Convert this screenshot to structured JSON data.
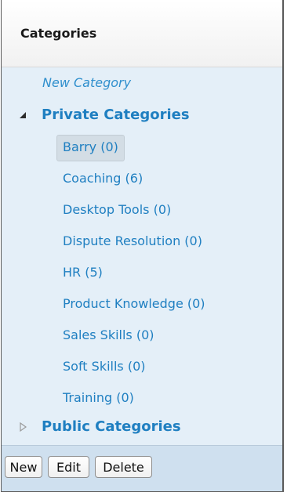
{
  "header": {
    "title": "Categories"
  },
  "tree": {
    "new_category": "New Category",
    "private_group": {
      "label": "Private Categories",
      "expanded": true,
      "items": [
        {
          "label": "Barry (0)",
          "selected": true
        },
        {
          "label": "Coaching (6)"
        },
        {
          "label": "Desktop Tools (0)"
        },
        {
          "label": "Dispute Resolution (0)"
        },
        {
          "label": "HR (5)"
        },
        {
          "label": "Product Knowledge (0)"
        },
        {
          "label": "Sales Skills (0)"
        },
        {
          "label": "Soft Skills (0)"
        },
        {
          "label": "Training (0)"
        }
      ]
    },
    "public_group": {
      "label": "Public Categories",
      "expanded": false
    }
  },
  "toolbar": {
    "new_label": "New",
    "edit_label": "Edit",
    "delete_label": "Delete"
  },
  "colors": {
    "link": "#1f7fc1",
    "tree_background": "#e4eff8",
    "toolbar_background": "#cfe0ef",
    "selected_background": "#d3dde5"
  },
  "icons": {
    "expanded_arrow": "triangle-down-right-icon",
    "collapsed_arrow": "triangle-right-icon"
  }
}
